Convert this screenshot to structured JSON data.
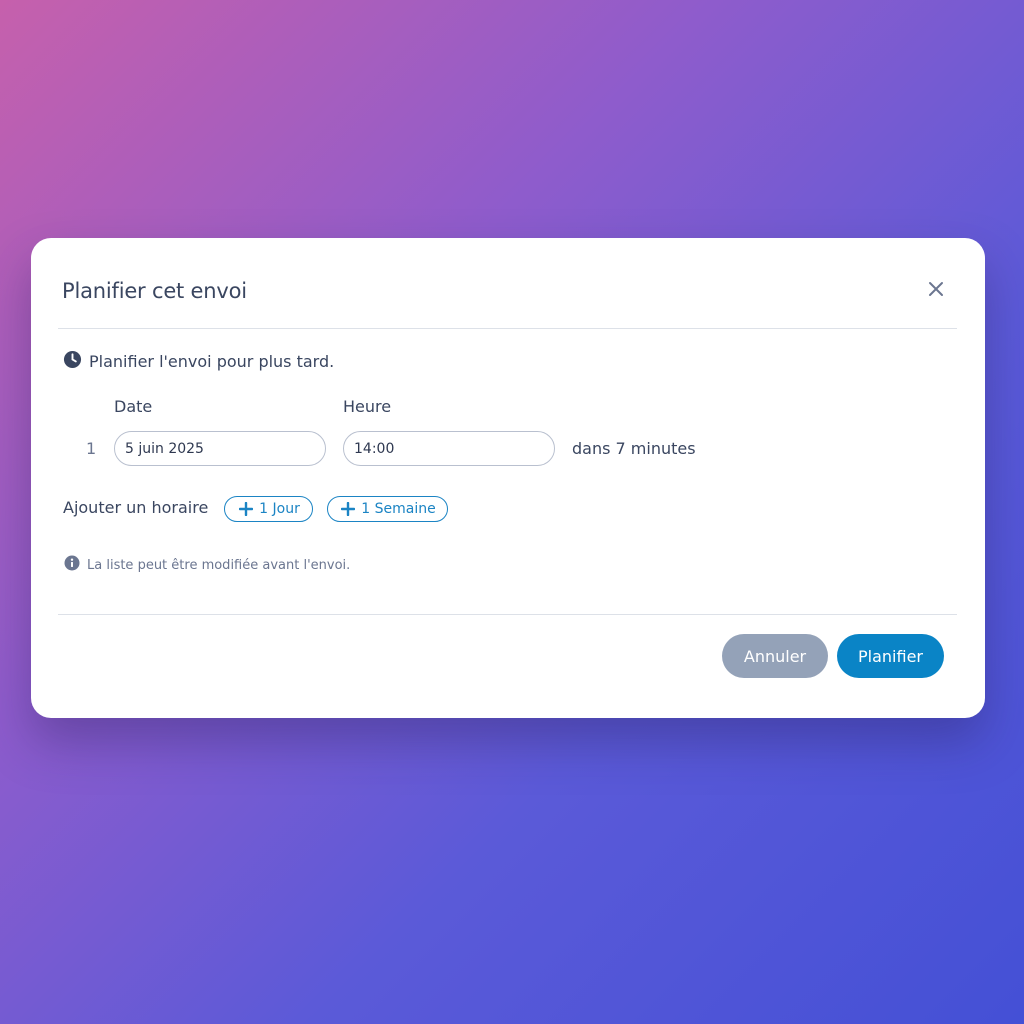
{
  "dialog": {
    "title": "Planifier cet envoi",
    "close_icon": "close-icon",
    "subtitle": "Planifier l'envoi pour plus tard.",
    "subtitle_icon": "clock-icon"
  },
  "schedule": {
    "date_label": "Date",
    "time_label": "Heure",
    "rows": [
      {
        "index": "1",
        "date_value": "5 juin 2025",
        "time_value": "14:00",
        "relative": "dans 7 minutes"
      }
    ]
  },
  "add_schedule": {
    "label": "Ajouter un horaire",
    "chips": [
      {
        "label": "1 Jour",
        "icon": "plus-icon"
      },
      {
        "label": "1 Semaine",
        "icon": "plus-icon"
      }
    ]
  },
  "info": {
    "icon": "info-icon",
    "text": "La liste peut être modifiée avant l'envoi."
  },
  "actions": {
    "cancel_label": "Annuler",
    "submit_label": "Planifier"
  },
  "colors": {
    "accent": "#0a84c6",
    "chip_border": "#1b84c4",
    "cancel_bg": "#94a2b8",
    "text": "#3a4660",
    "muted": "#6b7690"
  }
}
